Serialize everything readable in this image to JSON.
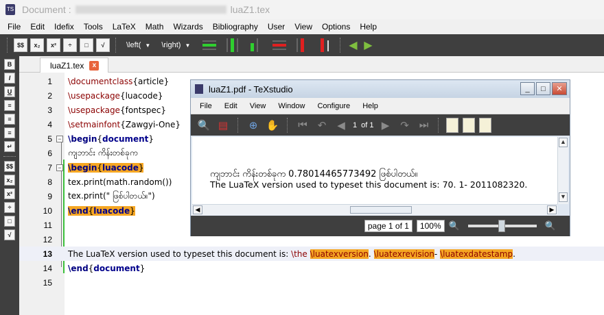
{
  "window": {
    "title_prefix": "Document :",
    "title_file": "luaZ1.tex"
  },
  "menubar": [
    "File",
    "Edit",
    "Idefix",
    "Tools",
    "LaTeX",
    "Math",
    "Wizards",
    "Bibliography",
    "User",
    "View",
    "Options",
    "Help"
  ],
  "toolbar": {
    "math_buttons": [
      "$$",
      "x₂",
      "x²",
      "÷",
      "□",
      "√"
    ],
    "left_combo": "\\left(",
    "right_combo": "\\right)"
  },
  "left_toolbar": [
    "B",
    "I",
    "U",
    "≡",
    "≡",
    "≡",
    "↵",
    "$$",
    "x₂",
    "x²",
    "÷",
    "□",
    "√"
  ],
  "tab": {
    "label": "luaZ1.tex",
    "close": "x"
  },
  "editor": {
    "lines": [
      {
        "n": "1",
        "text": "\\documentclass{article}"
      },
      {
        "n": "2",
        "text": "\\usepackage{luacode}"
      },
      {
        "n": "3",
        "text": "\\usepackage{fontspec}"
      },
      {
        "n": "4",
        "text": "\\setmainfont{Zawgyi-One}"
      },
      {
        "n": "5",
        "text": "\\begin{document}"
      },
      {
        "n": "6",
        "text": "ကျဘာင်း ကိန်းတစ်ခုက"
      },
      {
        "n": "7",
        "text": "\\begin{luacode}"
      },
      {
        "n": "8",
        "text": "tex.print(math.random())"
      },
      {
        "n": "9",
        "text": "tex.print(\" ဖြစ်ပါတယ်။\")"
      },
      {
        "n": "10",
        "text": "\\end{luacode}"
      },
      {
        "n": "11",
        "text": ""
      },
      {
        "n": "12",
        "text": ""
      },
      {
        "n": "13",
        "text": "The LuaTeX version used to typeset this document is: \\the \\luatexversion. \\luatexrevision- \\luatexdatestamp."
      },
      {
        "n": "14",
        "text": "\\end{document}"
      },
      {
        "n": "15",
        "text": ""
      }
    ],
    "line13_parts": {
      "prefix": "The LuaTeX version used to typeset this document is: ",
      "the": "\\the",
      "v1": "\\luatexversion",
      "dot": ".",
      "v2": "\\luatexrevision",
      "dash": "-",
      "v3": "\\luatexdatestamp",
      "end": "."
    }
  },
  "pdf_viewer": {
    "title": "luaZ1.pdf - TeXstudio",
    "menu": [
      "File",
      "Edit",
      "View",
      "Window",
      "Configure",
      "Help"
    ],
    "page_num": "1",
    "page_of": "of 1",
    "content_line1": "ကျဘာင်း ကိန်းတစ်ခုက  0.78014465773492 ဖြစ်ပါတယ်။",
    "content_line2": "The LuaTeX version used to typeset this document is:  70.  1- 2011082320.",
    "status_page": "page 1 of 1",
    "zoom": "100%"
  }
}
